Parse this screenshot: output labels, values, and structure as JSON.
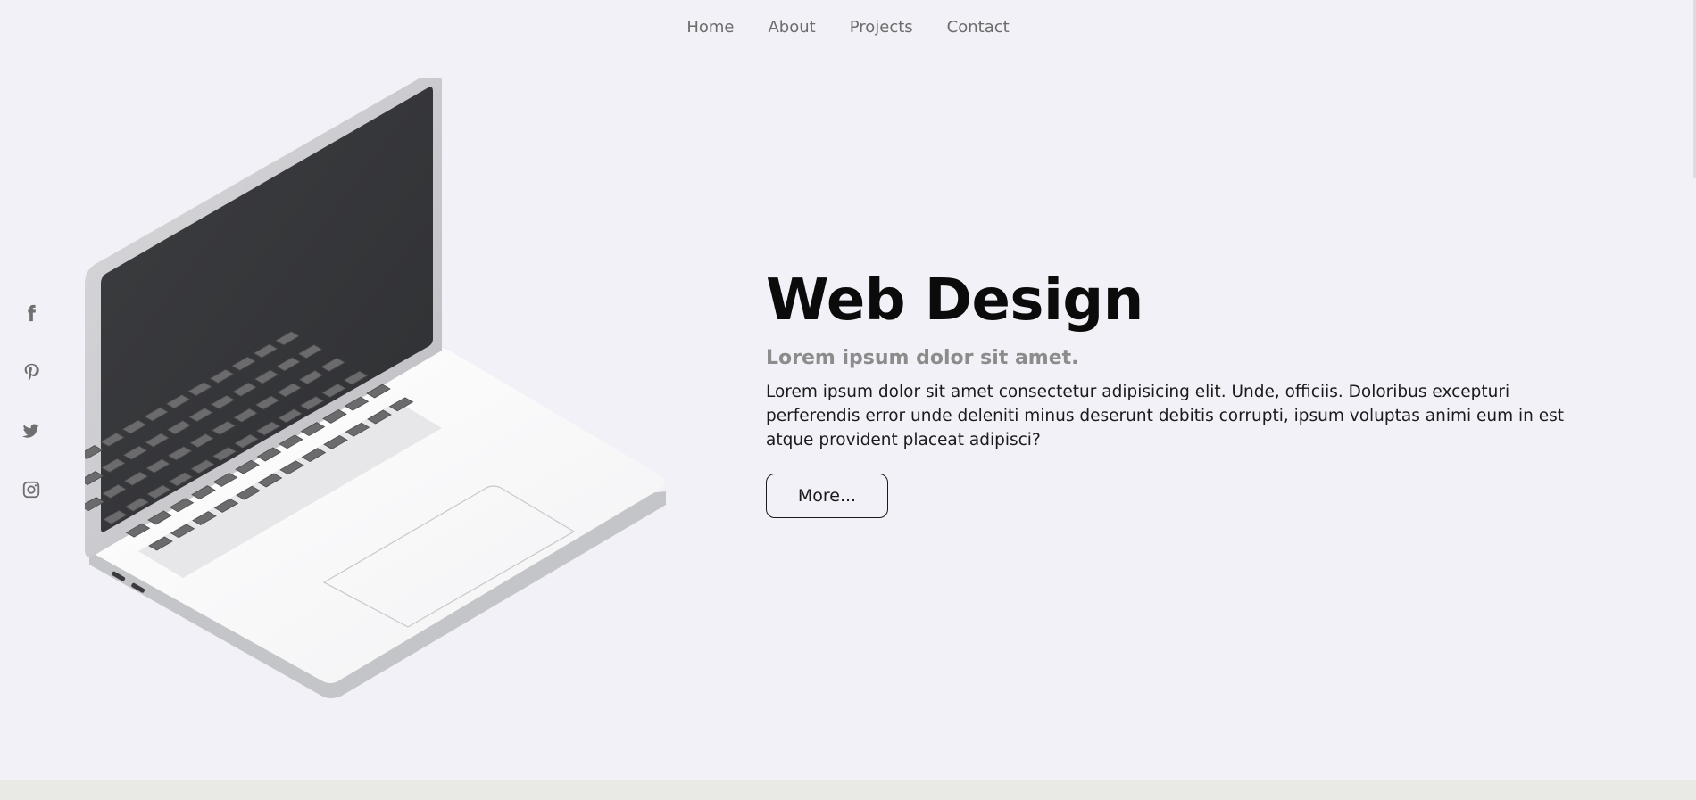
{
  "nav": {
    "items": [
      "Home",
      "About",
      "Projects",
      "Contact"
    ]
  },
  "social": {
    "icons": [
      "facebook-icon",
      "pinterest-icon",
      "twitter-icon",
      "instagram-icon"
    ]
  },
  "hero": {
    "title": "Web Design",
    "subtitle": "Lorem ipsum dolor sit amet.",
    "body": "Lorem ipsum dolor sit amet consectetur adipisicing elit. Unde, officiis. Doloribus excepturi perferendis error unde deleniti minus deserunt debitis corrupti, ipsum voluptas animi eum in est atque provident placeat adipisci?",
    "button_label": "More..."
  },
  "colors": {
    "background": "#f1f1f7",
    "footer_band": "#e9e9e6",
    "text": "#0b0b0b",
    "muted": "#8c8c8c"
  }
}
